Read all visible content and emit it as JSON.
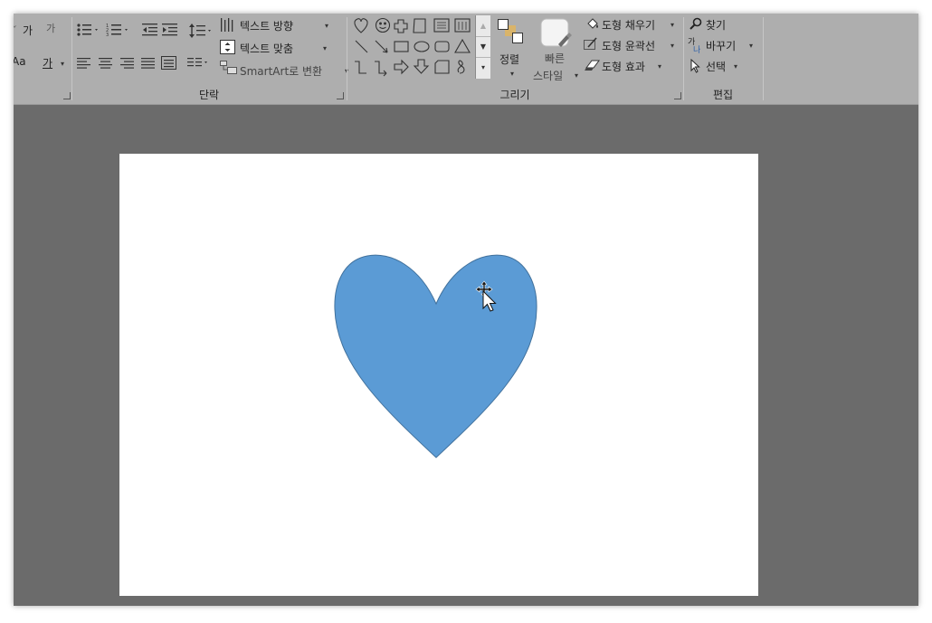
{
  "ribbon": {
    "font_group": {
      "grow_shrink": "가",
      "clear_format": "가",
      "text_case": "Aa",
      "font_color": "가"
    },
    "paragraph": {
      "label": "단락",
      "text_direction": "텍스트 방향",
      "align_text": "텍스트 맞춤",
      "smartart": "SmartArt로 변환"
    },
    "drawing": {
      "label": "그리기",
      "arrange": "정렬",
      "quick_styles_line1": "빠른",
      "quick_styles_line2": "스타일",
      "shape_fill": "도형 채우기",
      "shape_outline": "도형 윤곽선",
      "shape_effects": "도형 효과"
    },
    "editing": {
      "label": "편집",
      "find": "찾기",
      "replace": "바꾸기",
      "select": "선택"
    }
  },
  "slide": {
    "shape": "heart",
    "shape_color": "#5b9bd5",
    "outline_color": "#41719c"
  },
  "colors": {
    "ribbon_bg": "#aeaeae",
    "workspace_bg": "#6b6b6b",
    "slide_bg": "#ffffff"
  }
}
